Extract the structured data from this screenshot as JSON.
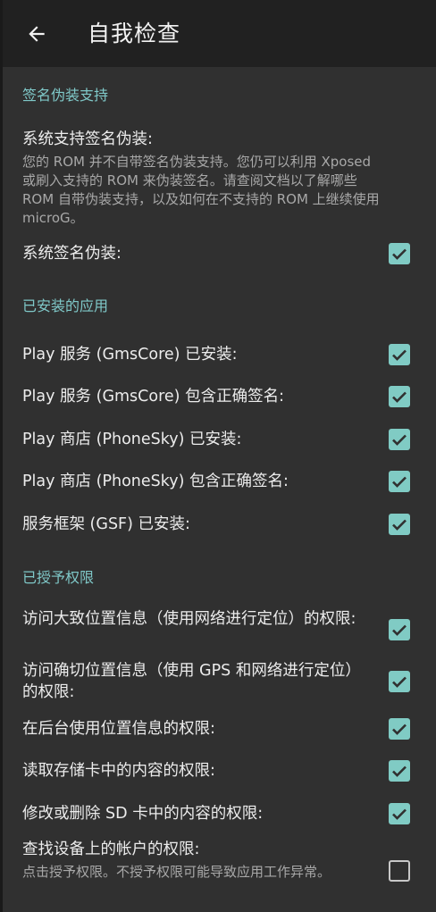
{
  "toolbar": {
    "title": "自我检查",
    "back_icon": "arrow-left-icon"
  },
  "colors": {
    "accent": "#80cbc4",
    "section_header": "#7fc8c8",
    "background": "#303030",
    "toolbar": "#212121"
  },
  "sections": {
    "signature": {
      "header": "签名伪装支持",
      "system_support": {
        "title": "系统支持签名伪装:",
        "summary": "您的 ROM 并不自带签名伪装支持。您仍可以利用 Xposed 或刷入支持的 ROM 来伪装签名。请查阅文档以了解哪些 ROM 自带伪装支持，以及如何在不支持的 ROM 上继续使用 microG。"
      },
      "system_spoof": {
        "title": "系统签名伪装:",
        "checked": true
      }
    },
    "apps": {
      "header": "已安装的应用",
      "items": [
        {
          "title": "Play 服务 (GmsCore) 已安装:",
          "checked": true
        },
        {
          "title": "Play 服务 (GmsCore) 包含正确签名:",
          "checked": true
        },
        {
          "title": "Play 商店 (PhoneSky) 已安装:",
          "checked": true
        },
        {
          "title": "Play 商店 (PhoneSky) 包含正确签名:",
          "checked": true
        },
        {
          "title": "服务框架 (GSF) 已安装:",
          "checked": true
        }
      ]
    },
    "permissions": {
      "header": "已授予权限",
      "items": [
        {
          "title": "访问大致位置信息（使用网络进行定位）的权限:",
          "checked": true
        },
        {
          "title": "访问确切位置信息（使用 GPS 和网络进行定位）的权限:",
          "checked": true
        },
        {
          "title": "在后台使用位置信息的权限:",
          "checked": true
        },
        {
          "title": "读取存储卡中的内容的权限:",
          "checked": true
        },
        {
          "title": "修改或删除 SD 卡中的内容的权限:",
          "checked": true
        },
        {
          "title": "查找设备上的帐户的权限:",
          "summary": "点击授予权限。不授予权限可能导致应用工作异常。",
          "checked": false
        }
      ]
    }
  }
}
